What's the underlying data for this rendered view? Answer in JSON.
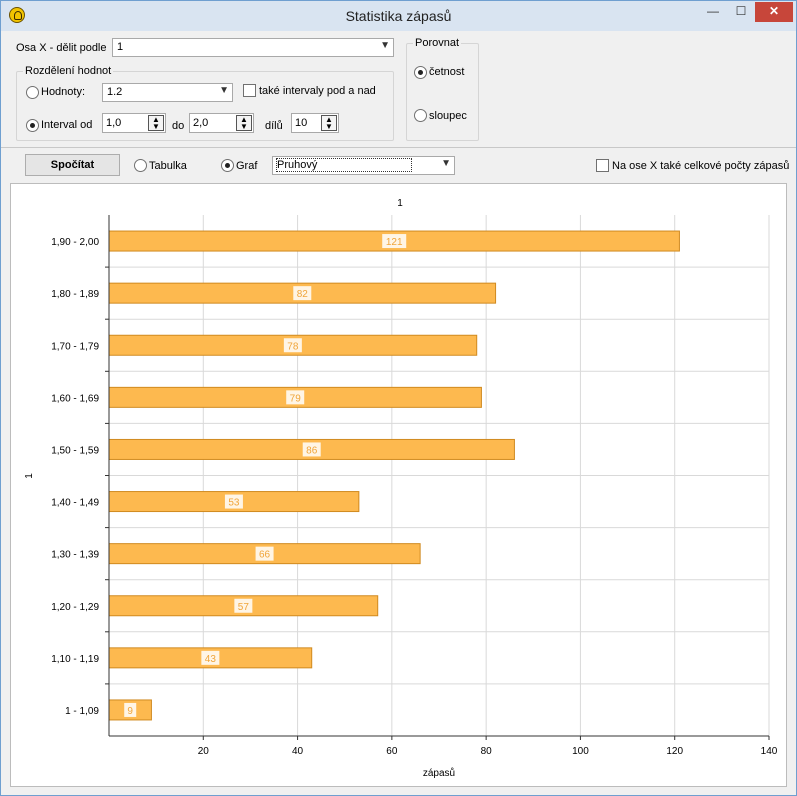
{
  "window": {
    "title": "Statistika zápasů",
    "min_glyph": "—",
    "max_glyph": "☐",
    "close_glyph": "✕"
  },
  "top": {
    "axis_x_label": "Osa X - dělit podle",
    "axis_x_value": "1",
    "distribution_caption": "Rozdělení hodnot",
    "values_radio_label": "Hodnoty:",
    "values_selected": false,
    "values_combo": "1.2",
    "intervals_check_label": "také intervaly pod a nad",
    "intervals_checked": false,
    "interval_radio_label": "Interval od",
    "interval_selected": true,
    "interval_from": "1,0",
    "to_label": "do",
    "interval_to": "2,0",
    "parts_label": "dílů",
    "parts_value": "10",
    "compare_caption": "Porovnat",
    "frequency_label": "četnost",
    "frequency_selected": true,
    "column_label": "sloupec",
    "column_selected": false
  },
  "toolbar": {
    "compute_label": "Spočítat",
    "table_label": "Tabulka",
    "table_selected": false,
    "graph_label": "Graf",
    "graph_selected": true,
    "graph_type": "Pruhový",
    "totals_label": "Na ose X také celkové počty zápasů",
    "totals_checked": false
  },
  "chart_data": {
    "type": "bar",
    "orientation": "horizontal",
    "title": "1",
    "xlabel": "zápasů",
    "ylabel": "1",
    "categories": [
      "1,90 - 2,00",
      "1,80 - 1,89",
      "1,70 - 1,79",
      "1,60 - 1,69",
      "1,50 - 1,59",
      "1,40 - 1,49",
      "1,30 - 1,39",
      "1,20 - 1,29",
      "1,10 - 1,19",
      "1 - 1,09"
    ],
    "values": [
      121,
      82,
      78,
      79,
      86,
      53,
      66,
      57,
      43,
      9
    ],
    "xlim": [
      0,
      140
    ],
    "xticks": [
      20,
      40,
      60,
      80,
      100,
      120,
      140
    ],
    "grid": true,
    "bar_color": "#fdb94f",
    "bar_border": "#d08a20"
  }
}
